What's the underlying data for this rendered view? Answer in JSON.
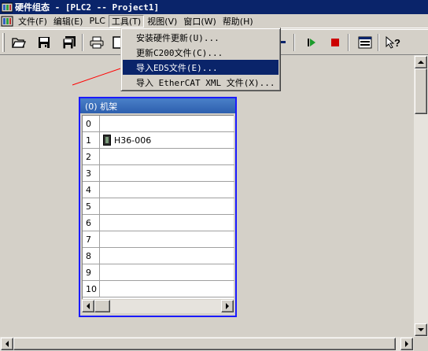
{
  "window": {
    "title": "硬件组态 - [PLC2 -- Project1]"
  },
  "menubar": {
    "items": [
      {
        "label": "文件(F)"
      },
      {
        "label": "编辑(E)"
      },
      {
        "label": "PLC"
      },
      {
        "label": "工具(T)"
      },
      {
        "label": "视图(V)"
      },
      {
        "label": "窗口(W)"
      },
      {
        "label": "帮助(H)"
      }
    ],
    "active_index": 3
  },
  "tools_menu": {
    "items": [
      {
        "label": "安装硬件更新(U)..."
      },
      {
        "label": "更新C200文件(C)..."
      },
      {
        "label": "导入EDS文件(E)..."
      },
      {
        "label": "导入 EtherCAT XML 文件(X)..."
      }
    ],
    "highlighted_index": 2
  },
  "toolbar": {
    "buttons": [
      "open-folder-icon",
      "save-icon",
      "save-all-icon",
      "print-icon",
      "compile-icon",
      "download-icon",
      "run-icon",
      "stop-icon",
      "catalog-icon",
      "context-help-icon"
    ]
  },
  "rack": {
    "title": "(0) 机架",
    "slots": [
      {
        "num": "0",
        "module": ""
      },
      {
        "num": "1",
        "module": "H36-006"
      },
      {
        "num": "2",
        "module": ""
      },
      {
        "num": "3",
        "module": ""
      },
      {
        "num": "4",
        "module": ""
      },
      {
        "num": "5",
        "module": ""
      },
      {
        "num": "6",
        "module": ""
      },
      {
        "num": "7",
        "module": ""
      },
      {
        "num": "8",
        "module": ""
      },
      {
        "num": "9",
        "module": ""
      },
      {
        "num": "10",
        "module": ""
      }
    ]
  },
  "colors": {
    "title_bar": "#0a246a",
    "menu_highlight": "#0a246a",
    "rack_border": "#1a1aff",
    "annotation_arrow": "#ff0000",
    "run_icon": "#1a9a2a",
    "stop_icon": "#cc0000"
  }
}
